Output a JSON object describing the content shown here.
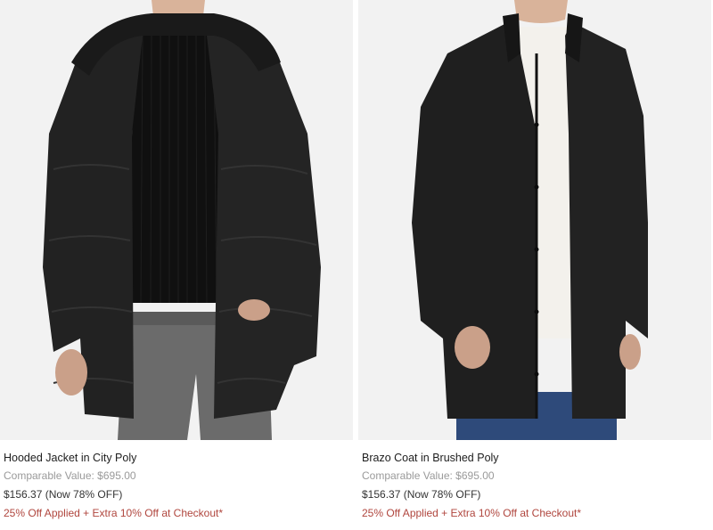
{
  "products": [
    {
      "image_alt": "Hooded Jacket in City Poly",
      "title": "Hooded Jacket in City Poly",
      "comparable_value": "Comparable Value: $695.00",
      "price": "$156.37 (Now 78% OFF)",
      "promo": "25% Off Applied + Extra 10% Off at Checkout*"
    },
    {
      "image_alt": "Brazo Coat in Brushed Poly",
      "title": "Brazo Coat in Brushed Poly",
      "comparable_value": "Comparable Value: $695.00",
      "price": "$156.37 (Now 78% OFF)",
      "promo": "25% Off Applied + Extra 10% Off at Checkout*"
    }
  ],
  "colors": {
    "image_bg": "#f2f2f2",
    "promo_red": "#b0463e",
    "comparable_gray": "#9a9a9a",
    "jacket_black": "#1f1f1f"
  }
}
